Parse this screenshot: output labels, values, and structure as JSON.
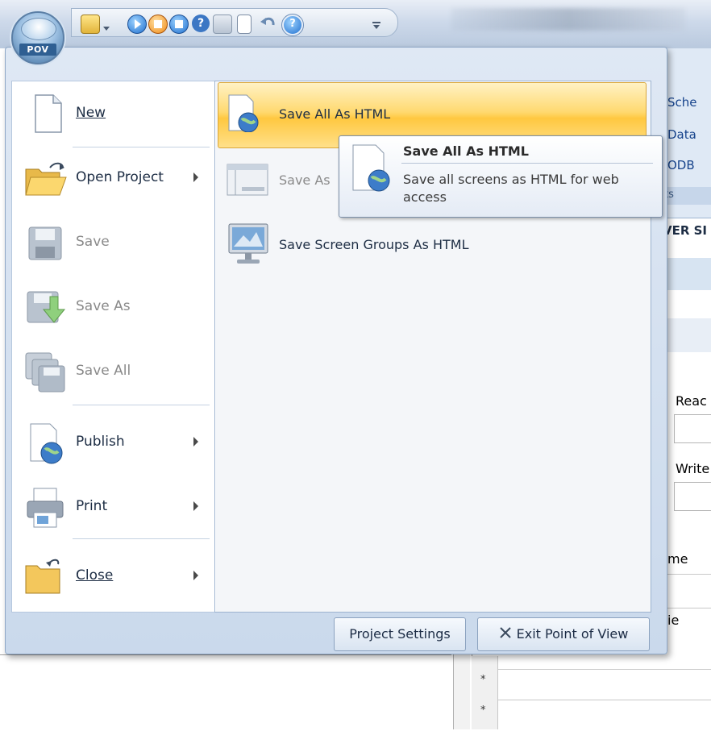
{
  "app": {
    "orb_label": "POV"
  },
  "background": {
    "ribbon_items": [
      "Sche",
      "Data",
      "ODB"
    ],
    "ribbon_group": "ts",
    "subtitle": "VER SI",
    "read_label": "Reac",
    "write_label": "Write",
    "grid_header": "me",
    "grid_row_label": "ie",
    "row_markers": [
      "*",
      "*"
    ]
  },
  "menu": {
    "left_items": [
      {
        "label": "New",
        "accel": "N",
        "enabled": true,
        "submenu": false,
        "icon": "new-document-icon"
      },
      {
        "label": "Open Project",
        "accel": "P",
        "enabled": true,
        "submenu": true,
        "icon": "open-folder-icon"
      },
      {
        "label": "Save",
        "accel": "S",
        "enabled": false,
        "submenu": false,
        "icon": "save-disk-icon"
      },
      {
        "label": "Save As",
        "accel": "A",
        "enabled": false,
        "submenu": false,
        "icon": "save-as-icon"
      },
      {
        "label": "Save All",
        "accel": "l",
        "enabled": false,
        "submenu": false,
        "icon": "save-all-icon"
      },
      {
        "label": "Publish",
        "accel": "u",
        "enabled": true,
        "submenu": true,
        "icon": "publish-globe-icon"
      },
      {
        "label": "Print",
        "accel": "P",
        "enabled": true,
        "submenu": true,
        "icon": "printer-icon"
      },
      {
        "label": "Close",
        "accel": "C",
        "enabled": true,
        "submenu": true,
        "icon": "close-folder-icon"
      }
    ],
    "right_items": [
      {
        "label": "Save All As HTML",
        "enabled": true,
        "highlighted": true,
        "icon": "html-globe-icon"
      },
      {
        "label": "Save As",
        "enabled": false,
        "highlighted": false,
        "icon": "screen-layout-icon"
      },
      {
        "label": "Save Screen Groups As HTML",
        "enabled": true,
        "highlighted": false,
        "icon": "monitor-icon"
      }
    ],
    "tooltip": {
      "title": "Save All As HTML",
      "description": "Save all screens as HTML for web access"
    },
    "footer": {
      "settings_label": "Project Settings",
      "exit_label": "Exit Point of View"
    }
  },
  "colors": {
    "highlight": "#ffd970",
    "menu_bg": "#dfe8f4",
    "text": "#1d2d44",
    "disabled": "#8a8a8a"
  }
}
